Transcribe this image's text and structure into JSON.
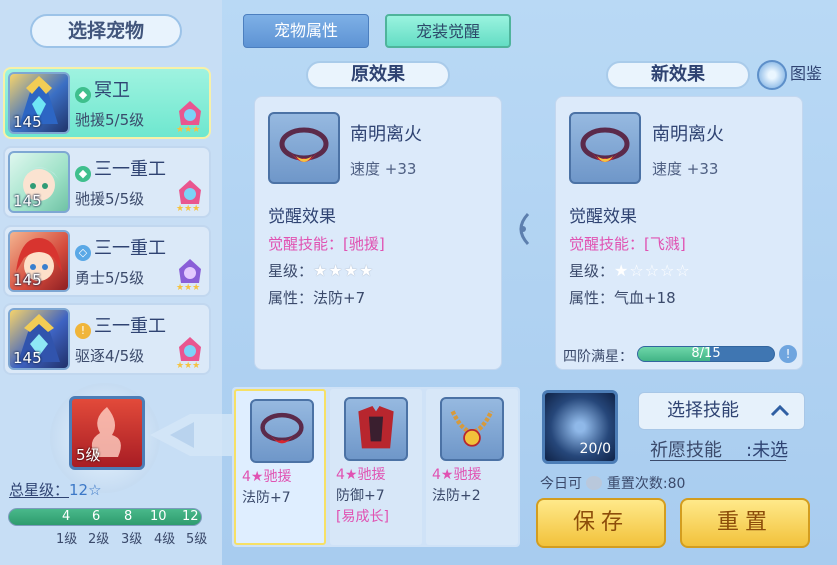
{
  "left": {
    "title": "选择宠物",
    "pets": [
      {
        "name": "冥卫",
        "type": "驰援5/5级",
        "level": "145",
        "selected": true
      },
      {
        "name": "三一重工",
        "type": "驰援5/5级",
        "level": "145",
        "selected": false
      },
      {
        "name": "三一重工",
        "type": "勇士5/5级",
        "level": "145",
        "selected": false
      },
      {
        "name": "三一重工",
        "type": "驱逐4/5级",
        "level": "145",
        "selected": false
      }
    ],
    "skill_level": "5级",
    "total_star_label": "总星级：",
    "total_star_value": "12☆",
    "progress_ticks": [
      "4",
      "6",
      "8",
      "10",
      "12"
    ],
    "grade_labels": [
      "1级",
      "2级",
      "3级",
      "4级",
      "5级"
    ]
  },
  "tabs": {
    "attr": "宠物属性",
    "awake": "宠装觉醒"
  },
  "original": {
    "section_title": "原效果",
    "equip_name": "南明离火",
    "equip_stat": "速度 +33",
    "awake_title": "觉醒效果",
    "skill_label": "觉醒技能：",
    "skill_value": "[驰援]",
    "star_label": "星级：",
    "stars": "★★★★",
    "attr_label": "属性：",
    "attr_value": "法防+7"
  },
  "new_effect": {
    "section_title": "新效果",
    "atlas_label": "图鉴",
    "equip_name": "南明离火",
    "equip_stat": "速度 +33",
    "awake_title": "觉醒效果",
    "skill_label": "觉醒技能：",
    "skill_value": "[飞溅]",
    "star_label": "星级：",
    "stars": "★☆☆☆☆",
    "attr_label": "属性：",
    "attr_value": "气血+18",
    "full_star_label": "四阶满星：",
    "progress_text": "8/15",
    "progress_fraction": 0.533
  },
  "choices": [
    {
      "title": "4★驰援",
      "stat": "法防+7",
      "extra": "",
      "selected": true
    },
    {
      "title": "4★驰援",
      "stat": "防御+7",
      "extra": "[易成长]",
      "selected": false
    },
    {
      "title": "4★驰援",
      "stat": "法防+2",
      "extra": "",
      "selected": false
    }
  ],
  "bottom_right": {
    "orb_count": "20/0",
    "select_skill": "选择技能",
    "wish_label": "祈愿技能",
    "wish_sep": ":",
    "wish_value": "未选",
    "reset_prefix": "今日可",
    "reset_suffix": "重置次数:80",
    "save": "保存",
    "reset": "重置"
  },
  "colors": {
    "accent_teal": "#6ee7cf",
    "pink": "#e052b2",
    "gold": "#f2c23b",
    "panel": "#dceafa"
  }
}
